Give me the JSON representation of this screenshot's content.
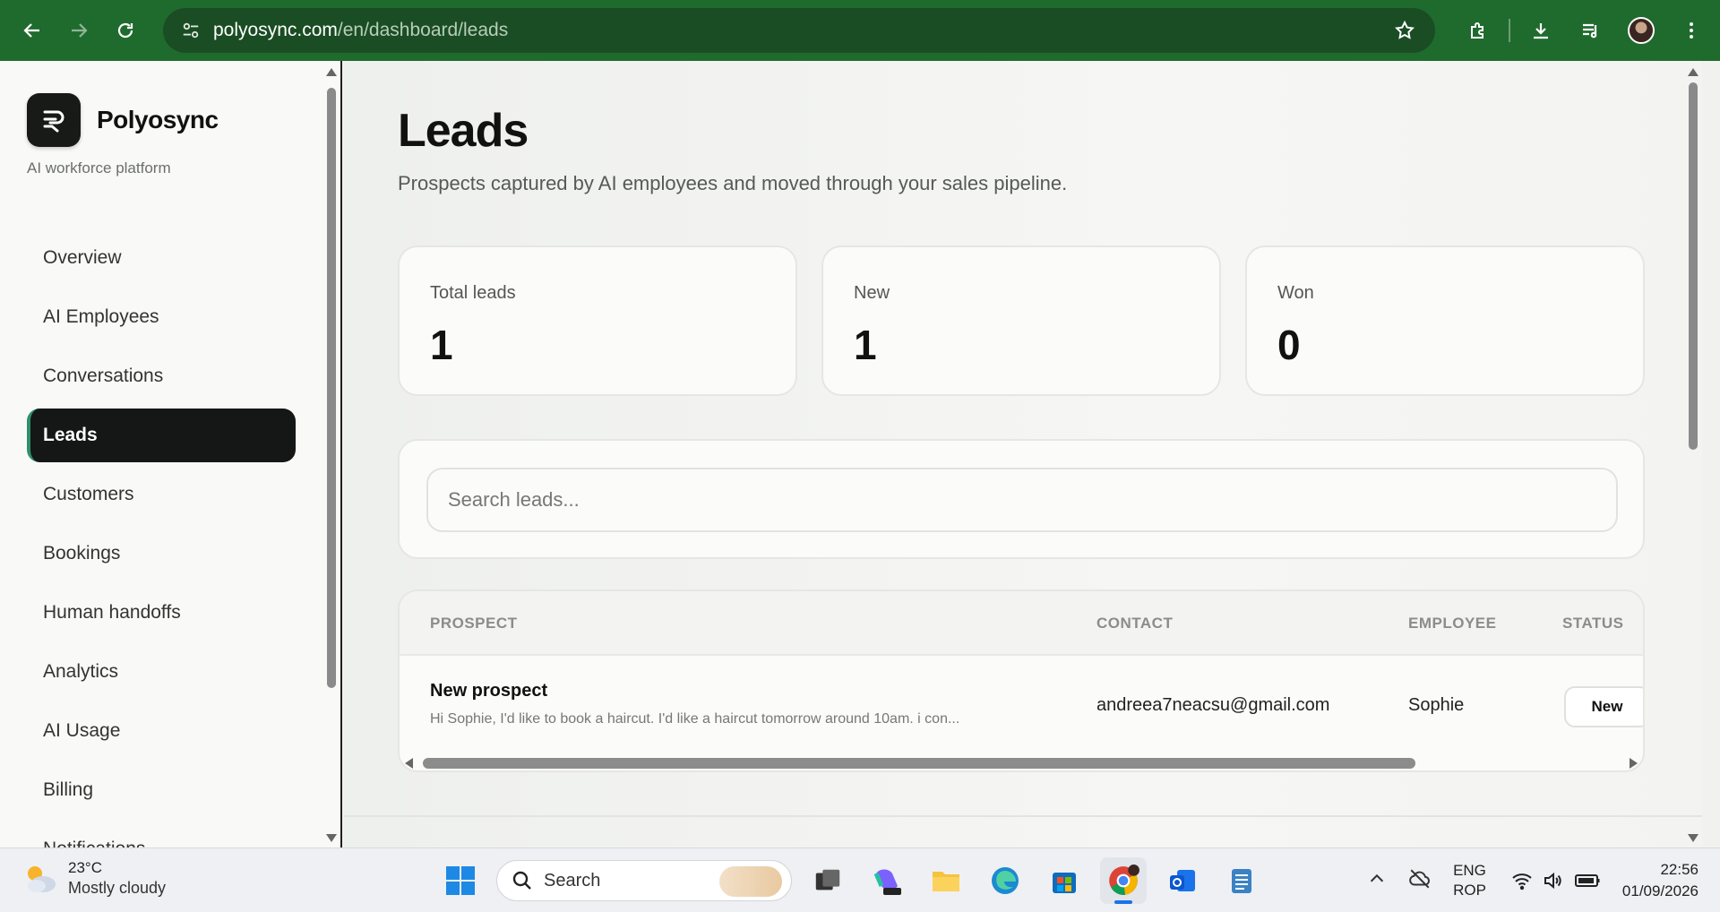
{
  "browser": {
    "url_host": "polyosync.com",
    "url_path": "/en/dashboard/leads"
  },
  "sidebar": {
    "brand": "Polyosync",
    "tagline": "AI workforce platform",
    "items": [
      {
        "label": "Overview"
      },
      {
        "label": "AI Employees"
      },
      {
        "label": "Conversations"
      },
      {
        "label": "Leads",
        "active": true
      },
      {
        "label": "Customers"
      },
      {
        "label": "Bookings"
      },
      {
        "label": "Human handoffs"
      },
      {
        "label": "Analytics"
      },
      {
        "label": "AI Usage"
      },
      {
        "label": "Billing"
      },
      {
        "label": "Notifications"
      }
    ]
  },
  "main": {
    "title": "Leads",
    "subtitle": "Prospects captured by AI employees and moved through your sales pipeline.",
    "stats": [
      {
        "label": "Total leads",
        "value": "1"
      },
      {
        "label": "New",
        "value": "1"
      },
      {
        "label": "Won",
        "value": "0"
      }
    ],
    "search_placeholder": "Search leads...",
    "table": {
      "headers": [
        "PROSPECT",
        "CONTACT",
        "EMPLOYEE",
        "STATUS"
      ],
      "rows": [
        {
          "prospect": "New prospect",
          "message": "Hi Sophie, I'd like to book a haircut. I'd like a haircut tomorrow around 10am. i con...",
          "contact": "andreea7neacsu@gmail.com",
          "employee": "Sophie",
          "status": "New"
        }
      ]
    }
  },
  "taskbar": {
    "temperature": "23°C",
    "condition": "Mostly cloudy",
    "search_label": "Search",
    "lang_top": "ENG",
    "lang_bottom": "ROP",
    "time": "22:56",
    "date": "01/09/2026"
  },
  "colors": {
    "browser_bar": "#1f6b2e",
    "nav_active": "#141716",
    "nav_active_accent": "#2f8f6a"
  }
}
